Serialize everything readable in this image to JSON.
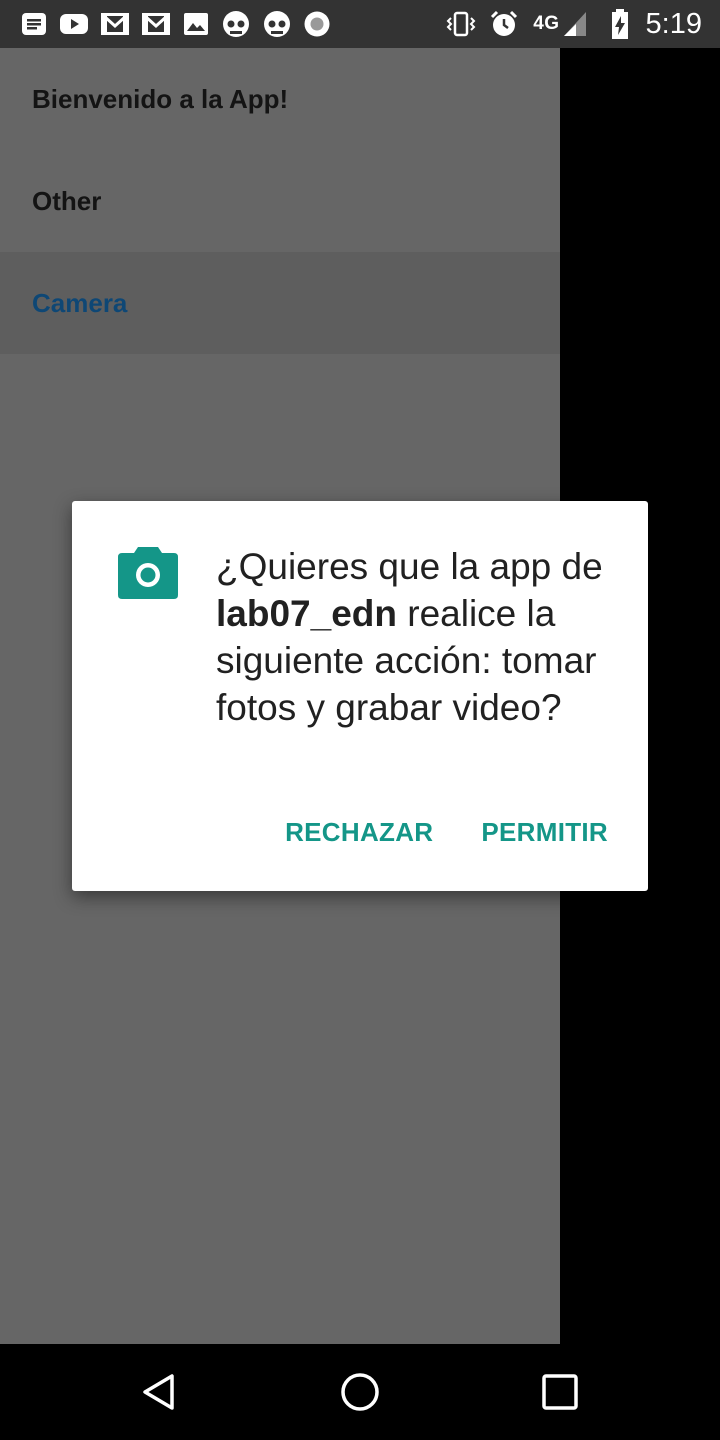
{
  "status_bar": {
    "left_icons": [
      "news-icon",
      "youtube-icon",
      "gmail-icon",
      "gmail-icon",
      "image-icon",
      "skull-icon",
      "skull-icon",
      "record-icon"
    ],
    "right_icons": [
      "vibrate-icon",
      "alarm-icon",
      "signal-icon",
      "battery-charging-icon"
    ],
    "network": "4G",
    "time": "5:19"
  },
  "drawer": {
    "items": [
      {
        "label": "Bienvenido a la App!",
        "selected": false
      },
      {
        "label": "Other",
        "selected": false
      },
      {
        "label": "Camera",
        "selected": true
      }
    ]
  },
  "dialog": {
    "icon": "camera-icon",
    "message_prefix": "¿Quieres que la app de ",
    "app_name": "lab07_edn",
    "message_suffix": " realice la siguiente acción: tomar fotos y grabar video?",
    "deny_label": "RECHAZAR",
    "allow_label": "PERMITIR",
    "accent_color": "#149688"
  },
  "nav_bar": {
    "buttons": [
      "back-icon",
      "home-icon",
      "recents-icon"
    ]
  }
}
